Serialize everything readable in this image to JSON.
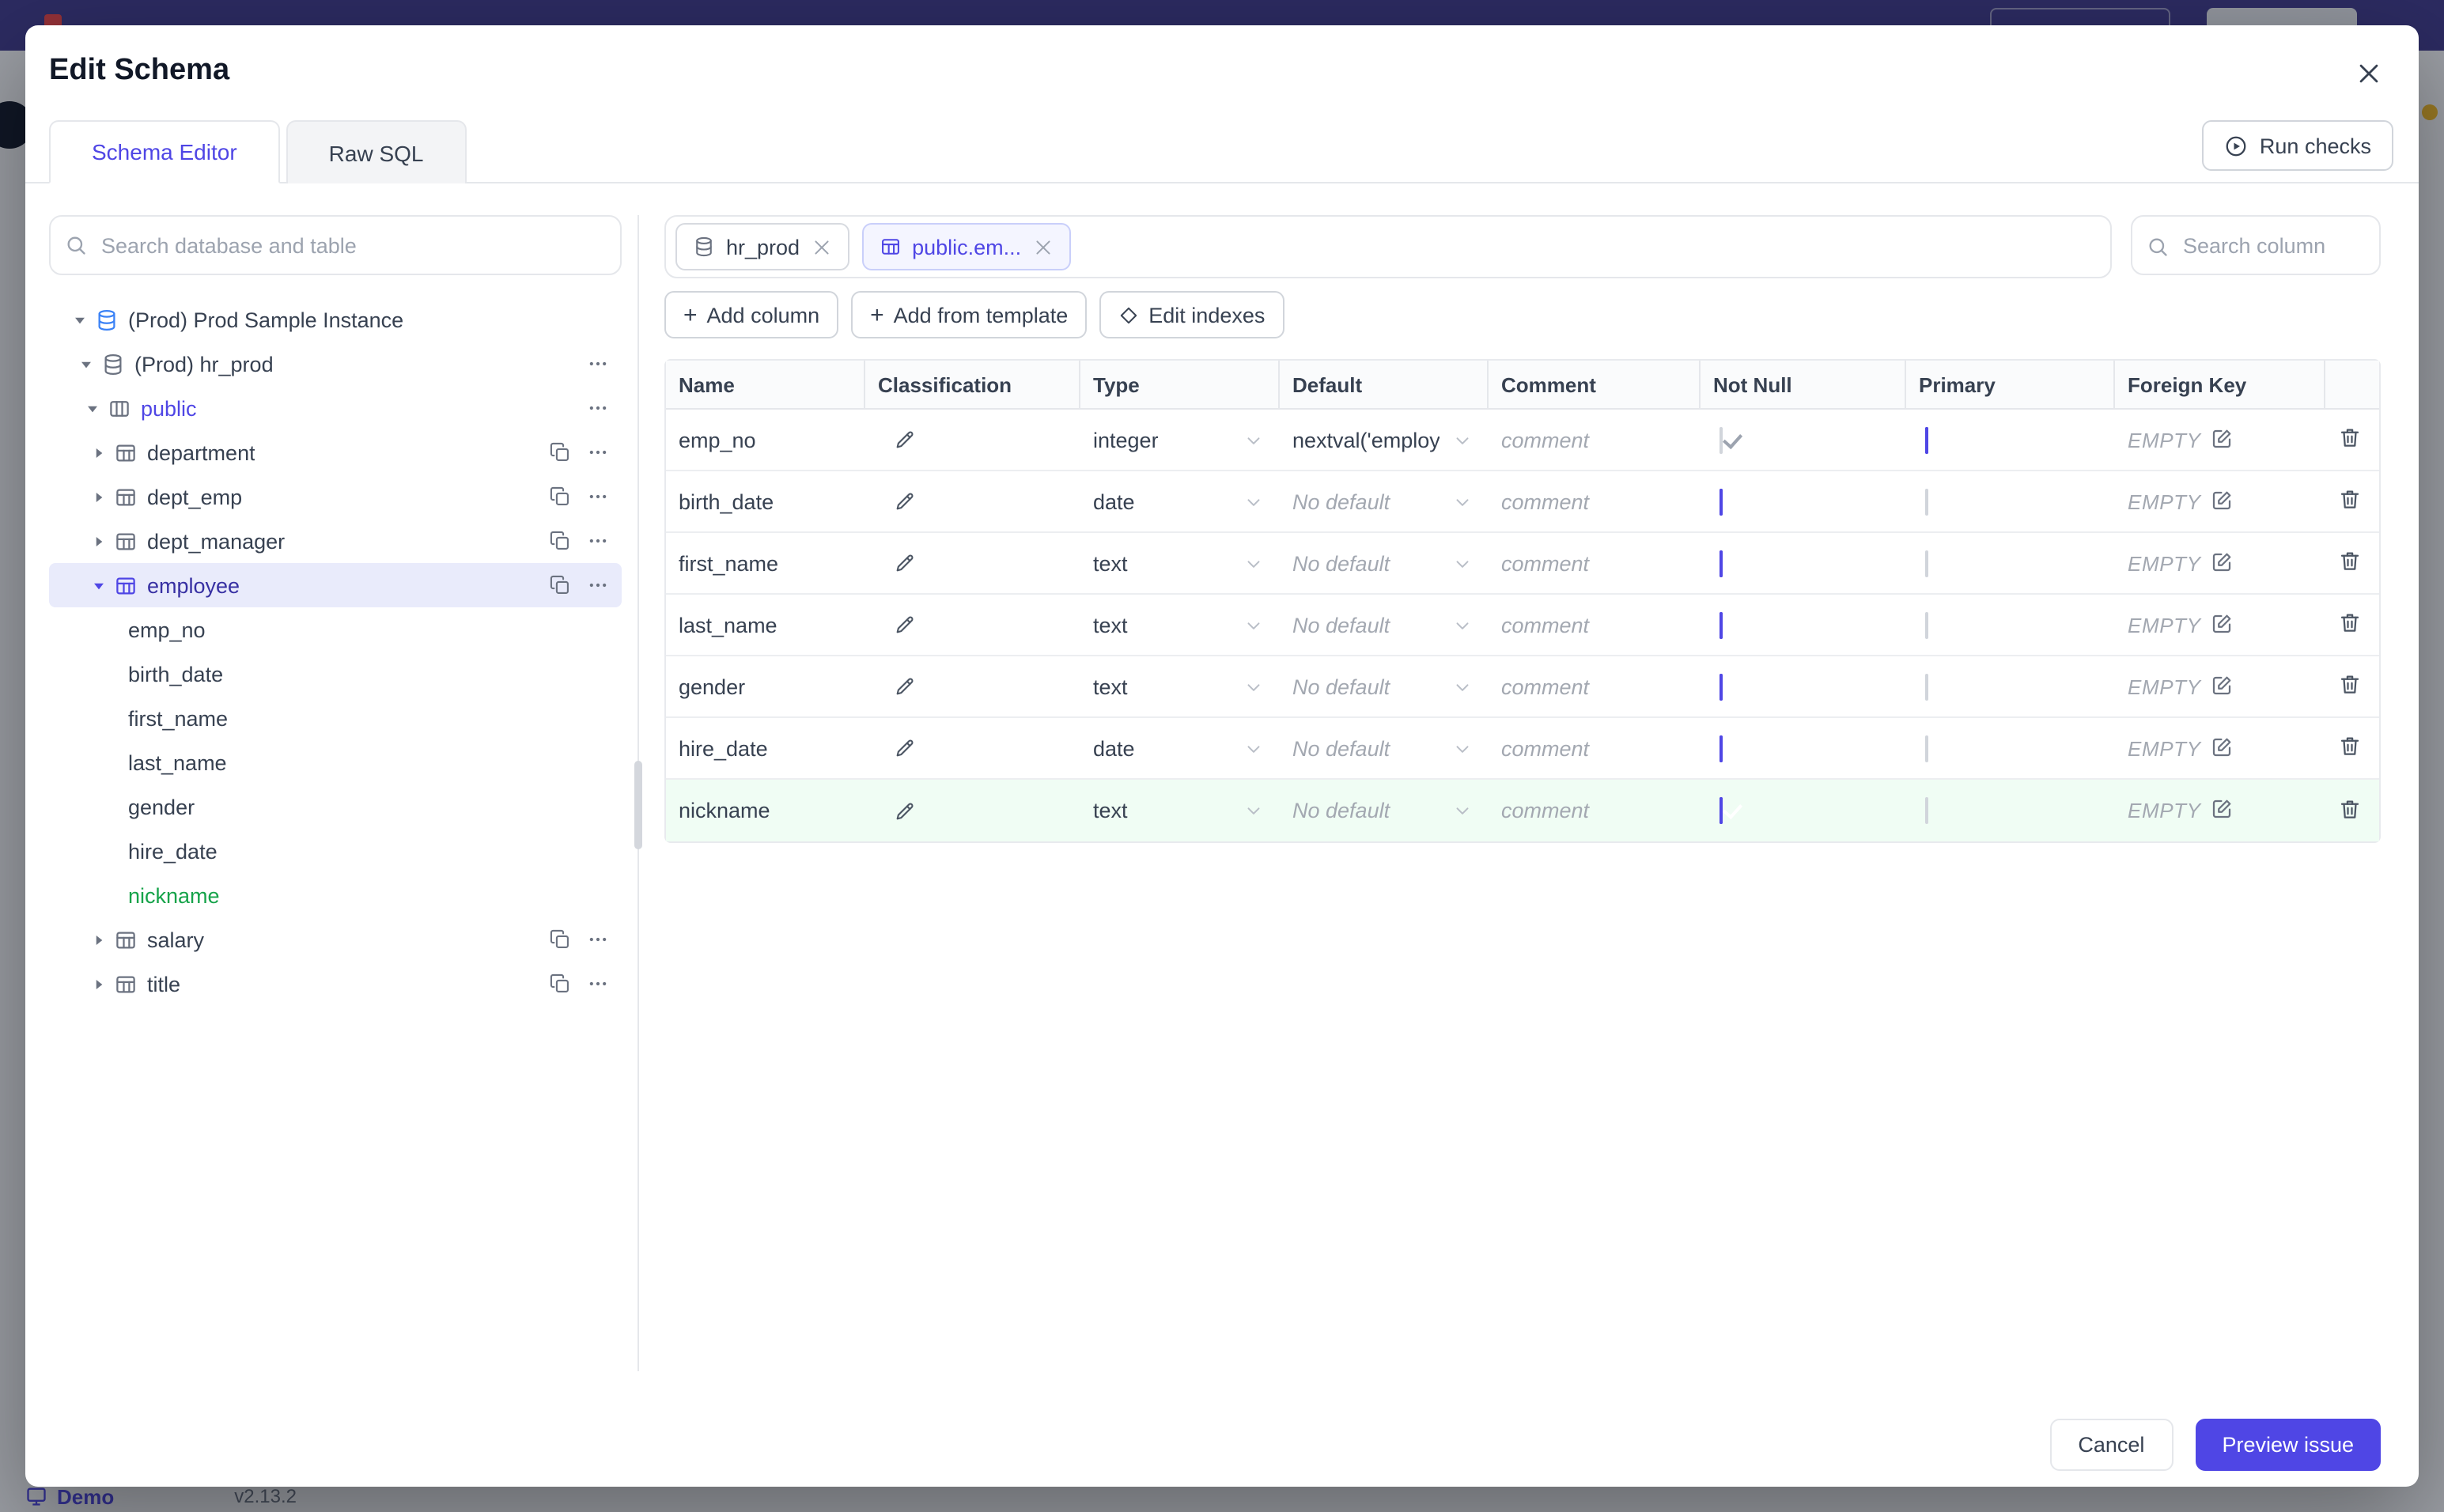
{
  "underlay": {
    "environment_label": "Demo",
    "version_label": "v2.13.2"
  },
  "modal": {
    "title": "Edit Schema",
    "tabs": [
      {
        "label": "Schema Editor",
        "active": true
      },
      {
        "label": "Raw SQL",
        "active": false
      }
    ],
    "run_checks_label": "Run checks"
  },
  "sidebar": {
    "search_placeholder": "Search database and table",
    "tree": [
      {
        "label": "(Prod) Prod Sample Instance",
        "level": 0,
        "caret": "down",
        "icon": "instance",
        "style": "default",
        "actions": []
      },
      {
        "label": "(Prod) hr_prod",
        "level": 1,
        "caret": "down",
        "icon": "database",
        "style": "default",
        "actions": [
          "more"
        ]
      },
      {
        "label": "public",
        "level": 2,
        "caret": "down",
        "icon": "schema",
        "style": "accent",
        "actions": [
          "more"
        ]
      },
      {
        "label": "department",
        "level": 3,
        "caret": "right",
        "icon": "table",
        "style": "default",
        "actions": [
          "copy",
          "more"
        ]
      },
      {
        "label": "dept_emp",
        "level": 3,
        "caret": "right",
        "icon": "table",
        "style": "default",
        "actions": [
          "copy",
          "more"
        ]
      },
      {
        "label": "dept_manager",
        "level": 3,
        "caret": "right",
        "icon": "table",
        "style": "default",
        "actions": [
          "copy",
          "more"
        ]
      },
      {
        "label": "employee",
        "level": 3,
        "caret": "down",
        "icon": "table",
        "style": "selected",
        "actions": [
          "copy",
          "more"
        ]
      },
      {
        "label": "emp_no",
        "level": 4,
        "caret": "none",
        "icon": "none",
        "style": "default",
        "actions": []
      },
      {
        "label": "birth_date",
        "level": 4,
        "caret": "none",
        "icon": "none",
        "style": "default",
        "actions": []
      },
      {
        "label": "first_name",
        "level": 4,
        "caret": "none",
        "icon": "none",
        "style": "default",
        "actions": []
      },
      {
        "label": "last_name",
        "level": 4,
        "caret": "none",
        "icon": "none",
        "style": "default",
        "actions": []
      },
      {
        "label": "gender",
        "level": 4,
        "caret": "none",
        "icon": "none",
        "style": "default",
        "actions": []
      },
      {
        "label": "hire_date",
        "level": 4,
        "caret": "none",
        "icon": "none",
        "style": "default",
        "actions": []
      },
      {
        "label": "nickname",
        "level": 4,
        "caret": "none",
        "icon": "none",
        "style": "green",
        "actions": []
      },
      {
        "label": "salary",
        "level": 3,
        "caret": "right",
        "icon": "table",
        "style": "default",
        "actions": [
          "copy",
          "more"
        ]
      },
      {
        "label": "title",
        "level": 3,
        "caret": "right",
        "icon": "table",
        "style": "default",
        "actions": [
          "copy",
          "more"
        ]
      }
    ]
  },
  "main": {
    "chips": [
      {
        "label": "hr_prod",
        "icon": "database",
        "selected": false
      },
      {
        "label": "public.em...",
        "icon": "table",
        "selected": true
      }
    ],
    "column_search_placeholder": "Search column",
    "toolbar": [
      {
        "label": "Add column",
        "icon": "plus"
      },
      {
        "label": "Add from template",
        "icon": "plus"
      },
      {
        "label": "Edit indexes",
        "icon": "diamond"
      }
    ],
    "table": {
      "columns": [
        "Name",
        "Classification",
        "Type",
        "Default",
        "Comment",
        "Not Null",
        "Primary",
        "Foreign Key",
        ""
      ],
      "comment_placeholder": "comment",
      "foreign_key_empty_label": "EMPTY",
      "rows": [
        {
          "name": "emp_no",
          "type": "integer",
          "default": "nextval('employ",
          "default_is_placeholder": false,
          "not_null": "checked_disabled",
          "primary": "checked",
          "highlight": ""
        },
        {
          "name": "birth_date",
          "type": "date",
          "default": "No default",
          "default_is_placeholder": true,
          "not_null": "checked",
          "primary": "unchecked",
          "highlight": ""
        },
        {
          "name": "first_name",
          "type": "text",
          "default": "No default",
          "default_is_placeholder": true,
          "not_null": "checked",
          "primary": "unchecked",
          "highlight": ""
        },
        {
          "name": "last_name",
          "type": "text",
          "default": "No default",
          "default_is_placeholder": true,
          "not_null": "checked",
          "primary": "unchecked",
          "highlight": ""
        },
        {
          "name": "gender",
          "type": "text",
          "default": "No default",
          "default_is_placeholder": true,
          "not_null": "checked",
          "primary": "unchecked",
          "highlight": ""
        },
        {
          "name": "hire_date",
          "type": "date",
          "default": "No default",
          "default_is_placeholder": true,
          "not_null": "checked",
          "primary": "unchecked",
          "highlight": ""
        },
        {
          "name": "nickname",
          "type": "text",
          "default": "No default",
          "default_is_placeholder": true,
          "not_null": "checked",
          "primary": "unchecked",
          "highlight": "green"
        }
      ]
    }
  },
  "footer": {
    "cancel_label": "Cancel",
    "primary_label": "Preview issue"
  },
  "colors": {
    "accent": "#4f46e5",
    "green": "#16a34a",
    "overlay": "rgba(17,24,39,0.42)",
    "topbar": "#413a8c"
  }
}
